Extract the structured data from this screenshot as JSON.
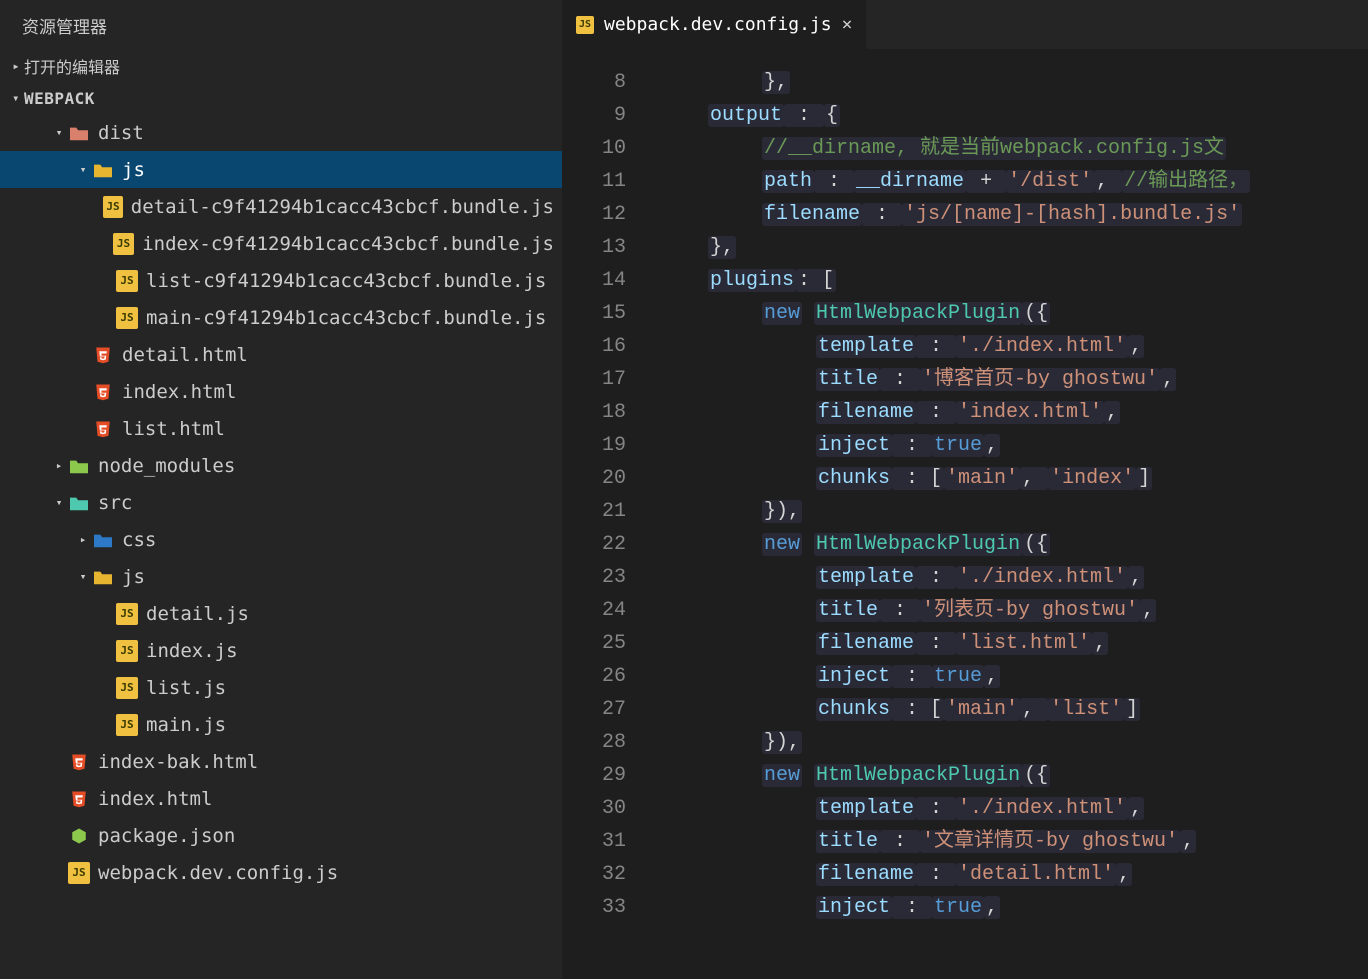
{
  "sidebar": {
    "title": "资源管理器",
    "open_editors_label": "打开的编辑器",
    "project_label": "WEBPACK"
  },
  "tree": [
    {
      "depth": 0,
      "twisty": "▾",
      "iconType": "folder-dist",
      "label": "dist",
      "name": "folder-dist"
    },
    {
      "depth": 1,
      "twisty": "▾",
      "iconType": "folder-js",
      "label": "js",
      "name": "folder-dist-js",
      "selected": true
    },
    {
      "depth": 2,
      "twisty": "",
      "iconType": "js",
      "label": "detail-c9f41294b1cacc43cbcf.bundle.js",
      "name": "file-detail-bundle"
    },
    {
      "depth": 2,
      "twisty": "",
      "iconType": "js",
      "label": "index-c9f41294b1cacc43cbcf.bundle.js",
      "name": "file-index-bundle"
    },
    {
      "depth": 2,
      "twisty": "",
      "iconType": "js",
      "label": "list-c9f41294b1cacc43cbcf.bundle.js",
      "name": "file-list-bundle"
    },
    {
      "depth": 2,
      "twisty": "",
      "iconType": "js",
      "label": "main-c9f41294b1cacc43cbcf.bundle.js",
      "name": "file-main-bundle"
    },
    {
      "depth": 1,
      "twisty": "",
      "iconType": "html",
      "label": "detail.html",
      "name": "file-detail-html"
    },
    {
      "depth": 1,
      "twisty": "",
      "iconType": "html",
      "label": "index.html",
      "name": "file-dist-index-html"
    },
    {
      "depth": 1,
      "twisty": "",
      "iconType": "html",
      "label": "list.html",
      "name": "file-list-html"
    },
    {
      "depth": 0,
      "twisty": "▸",
      "iconType": "folder-node",
      "label": "node_modules",
      "name": "folder-node-modules"
    },
    {
      "depth": 0,
      "twisty": "▾",
      "iconType": "folder-src",
      "label": "src",
      "name": "folder-src"
    },
    {
      "depth": 1,
      "twisty": "▸",
      "iconType": "folder-css",
      "label": "css",
      "name": "folder-css"
    },
    {
      "depth": 1,
      "twisty": "▾",
      "iconType": "folder-js",
      "label": "js",
      "name": "folder-src-js"
    },
    {
      "depth": 2,
      "twisty": "",
      "iconType": "js",
      "label": "detail.js",
      "name": "file-detail-js"
    },
    {
      "depth": 2,
      "twisty": "",
      "iconType": "js",
      "label": "index.js",
      "name": "file-index-js"
    },
    {
      "depth": 2,
      "twisty": "",
      "iconType": "js",
      "label": "list.js",
      "name": "file-list-js"
    },
    {
      "depth": 2,
      "twisty": "",
      "iconType": "js",
      "label": "main.js",
      "name": "file-main-js"
    },
    {
      "depth": 0,
      "twisty": "",
      "iconType": "html",
      "label": "index-bak.html",
      "name": "file-index-bak-html"
    },
    {
      "depth": 0,
      "twisty": "",
      "iconType": "html",
      "label": "index.html",
      "name": "file-root-index-html"
    },
    {
      "depth": 0,
      "twisty": "",
      "iconType": "node",
      "label": "package.json",
      "name": "file-package-json"
    },
    {
      "depth": 0,
      "twisty": "",
      "iconType": "js",
      "label": "webpack.dev.config.js",
      "name": "file-webpack-config"
    }
  ],
  "tab": {
    "label": "webpack.dev.config.js"
  },
  "line_numbers": [
    "8",
    "9",
    "10",
    "11",
    "12",
    "13",
    "14",
    "15",
    "16",
    "17",
    "18",
    "19",
    "20",
    "21",
    "22",
    "23",
    "24",
    "25",
    "26",
    "27",
    "28",
    "29",
    "30",
    "31",
    "32",
    "33"
  ],
  "code": [
    [
      {
        "ind": 2
      },
      {
        "t": "},",
        "cls": "punct",
        "hl": true
      }
    ],
    [
      {
        "ind": 1
      },
      {
        "t": "output",
        "cls": "key",
        "hl": true
      },
      {
        "t": " : ",
        "cls": "punct",
        "hl": true
      },
      {
        "t": "{",
        "cls": "punct",
        "hl": true
      }
    ],
    [
      {
        "ind": 2
      },
      {
        "t": "//__dirname, 就是当前webpack.config.js文",
        "cls": "com",
        "hl": true
      }
    ],
    [
      {
        "ind": 2
      },
      {
        "t": "path",
        "cls": "key",
        "hl": true
      },
      {
        "t": " : ",
        "cls": "punct",
        "hl": true
      },
      {
        "t": "__dirname",
        "cls": "ident",
        "hl": true
      },
      {
        "t": " + ",
        "cls": "punct",
        "hl": true
      },
      {
        "t": "'/dist'",
        "cls": "str",
        "hl": true
      },
      {
        "t": ", ",
        "cls": "punct",
        "hl": true
      },
      {
        "t": "//输出路径，",
        "cls": "com",
        "hl": true
      }
    ],
    [
      {
        "ind": 2
      },
      {
        "t": "filename",
        "cls": "key",
        "hl": true
      },
      {
        "t": " : ",
        "cls": "punct",
        "hl": true
      },
      {
        "t": "'js/[name]-[hash].bundle.js'",
        "cls": "str",
        "hl": true
      }
    ],
    [
      {
        "ind": 1
      },
      {
        "t": "},",
        "cls": "punct",
        "hl": true
      }
    ],
    [
      {
        "ind": 1
      },
      {
        "t": "plugins",
        "cls": "key",
        "hl": true
      },
      {
        "t": ": [",
        "cls": "punct",
        "hl": true
      }
    ],
    [
      {
        "ind": 2
      },
      {
        "t": "new",
        "cls": "kw",
        "hl": true
      },
      {
        "t": " ",
        "cls": "punct"
      },
      {
        "t": "HtmlWebpackPlugin",
        "cls": "cls",
        "hl": true
      },
      {
        "t": "({",
        "cls": "punct",
        "hl": true
      }
    ],
    [
      {
        "ind": 3
      },
      {
        "t": "template",
        "cls": "key",
        "hl": true
      },
      {
        "t": " : ",
        "cls": "punct",
        "hl": true
      },
      {
        "t": "'./index.html'",
        "cls": "str",
        "hl": true
      },
      {
        "t": ",",
        "cls": "punct",
        "hl": true
      }
    ],
    [
      {
        "ind": 3
      },
      {
        "t": "title",
        "cls": "key",
        "hl": true
      },
      {
        "t": " : ",
        "cls": "punct",
        "hl": true
      },
      {
        "t": "'博客首页-by ghostwu'",
        "cls": "str",
        "hl": true
      },
      {
        "t": ",",
        "cls": "punct",
        "hl": true
      }
    ],
    [
      {
        "ind": 3
      },
      {
        "t": "filename",
        "cls": "key",
        "hl": true
      },
      {
        "t": " : ",
        "cls": "punct",
        "hl": true
      },
      {
        "t": "'index.html'",
        "cls": "str",
        "hl": true
      },
      {
        "t": ",",
        "cls": "punct",
        "hl": true
      }
    ],
    [
      {
        "ind": 3
      },
      {
        "t": "inject",
        "cls": "key",
        "hl": true
      },
      {
        "t": " : ",
        "cls": "punct",
        "hl": true
      },
      {
        "t": "true",
        "cls": "bool",
        "hl": true
      },
      {
        "t": ",",
        "cls": "punct",
        "hl": true
      }
    ],
    [
      {
        "ind": 3
      },
      {
        "t": "chunks",
        "cls": "key",
        "hl": true
      },
      {
        "t": " : [",
        "cls": "punct",
        "hl": true
      },
      {
        "t": "'main'",
        "cls": "str",
        "hl": true
      },
      {
        "t": ", ",
        "cls": "punct",
        "hl": true
      },
      {
        "t": "'index'",
        "cls": "str",
        "hl": true
      },
      {
        "t": "]",
        "cls": "punct",
        "hl": true
      }
    ],
    [
      {
        "ind": 2
      },
      {
        "t": "}),",
        "cls": "punct",
        "hl": true
      }
    ],
    [
      {
        "ind": 2
      },
      {
        "t": "new",
        "cls": "kw",
        "hl": true
      },
      {
        "t": " ",
        "cls": "punct"
      },
      {
        "t": "HtmlWebpackPlugin",
        "cls": "cls",
        "hl": true
      },
      {
        "t": "({",
        "cls": "punct",
        "hl": true
      }
    ],
    [
      {
        "ind": 3
      },
      {
        "t": "template",
        "cls": "key",
        "hl": true
      },
      {
        "t": " : ",
        "cls": "punct",
        "hl": true
      },
      {
        "t": "'./index.html'",
        "cls": "str",
        "hl": true
      },
      {
        "t": ",",
        "cls": "punct",
        "hl": true
      }
    ],
    [
      {
        "ind": 3
      },
      {
        "t": "title",
        "cls": "key",
        "hl": true
      },
      {
        "t": " : ",
        "cls": "punct",
        "hl": true
      },
      {
        "t": "'列表页-by ghostwu'",
        "cls": "str",
        "hl": true
      },
      {
        "t": ",",
        "cls": "punct",
        "hl": true
      }
    ],
    [
      {
        "ind": 3
      },
      {
        "t": "filename",
        "cls": "key",
        "hl": true
      },
      {
        "t": " : ",
        "cls": "punct",
        "hl": true
      },
      {
        "t": "'list.html'",
        "cls": "str",
        "hl": true
      },
      {
        "t": ",",
        "cls": "punct",
        "hl": true
      }
    ],
    [
      {
        "ind": 3
      },
      {
        "t": "inject",
        "cls": "key",
        "hl": true
      },
      {
        "t": " : ",
        "cls": "punct",
        "hl": true
      },
      {
        "t": "true",
        "cls": "bool",
        "hl": true
      },
      {
        "t": ",",
        "cls": "punct",
        "hl": true
      }
    ],
    [
      {
        "ind": 3
      },
      {
        "t": "chunks",
        "cls": "key",
        "hl": true
      },
      {
        "t": " : [",
        "cls": "punct",
        "hl": true
      },
      {
        "t": "'main'",
        "cls": "str",
        "hl": true
      },
      {
        "t": ", ",
        "cls": "punct",
        "hl": true
      },
      {
        "t": "'list'",
        "cls": "str",
        "hl": true
      },
      {
        "t": "]",
        "cls": "punct",
        "hl": true
      }
    ],
    [
      {
        "ind": 2
      },
      {
        "t": "}),",
        "cls": "punct",
        "hl": true
      }
    ],
    [
      {
        "ind": 2
      },
      {
        "t": "new",
        "cls": "kw",
        "hl": true
      },
      {
        "t": " ",
        "cls": "punct"
      },
      {
        "t": "HtmlWebpackPlugin",
        "cls": "cls",
        "hl": true
      },
      {
        "t": "({",
        "cls": "punct",
        "hl": true
      }
    ],
    [
      {
        "ind": 3
      },
      {
        "t": "template",
        "cls": "key",
        "hl": true
      },
      {
        "t": " : ",
        "cls": "punct",
        "hl": true
      },
      {
        "t": "'./index.html'",
        "cls": "str",
        "hl": true
      },
      {
        "t": ",",
        "cls": "punct",
        "hl": true
      }
    ],
    [
      {
        "ind": 3
      },
      {
        "t": "title",
        "cls": "key",
        "hl": true
      },
      {
        "t": " : ",
        "cls": "punct",
        "hl": true
      },
      {
        "t": "'文章详情页-by ghostwu'",
        "cls": "str",
        "hl": true
      },
      {
        "t": ",",
        "cls": "punct",
        "hl": true
      }
    ],
    [
      {
        "ind": 3
      },
      {
        "t": "filename",
        "cls": "key",
        "hl": true
      },
      {
        "t": " : ",
        "cls": "punct",
        "hl": true
      },
      {
        "t": "'detail.html'",
        "cls": "str",
        "hl": true
      },
      {
        "t": ",",
        "cls": "punct",
        "hl": true
      }
    ],
    [
      {
        "ind": 3
      },
      {
        "t": "inject",
        "cls": "key",
        "hl": true
      },
      {
        "t": " : ",
        "cls": "punct",
        "hl": true
      },
      {
        "t": "true",
        "cls": "bool",
        "hl": true
      },
      {
        "t": ",",
        "cls": "punct",
        "hl": true
      }
    ]
  ]
}
